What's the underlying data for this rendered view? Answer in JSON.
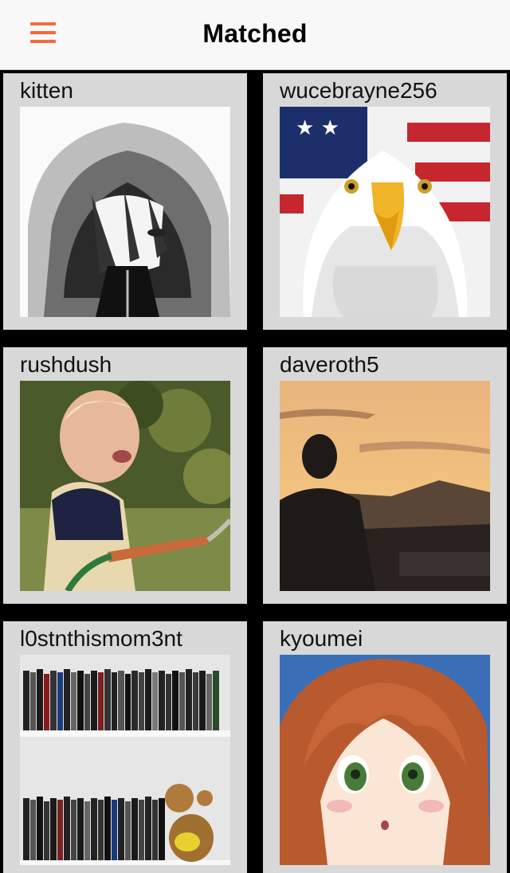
{
  "header": {
    "title": "Matched",
    "menu_icon": "hamburger-menu-icon",
    "accent_color": "#f26b3a"
  },
  "matches": [
    {
      "username": "kitten",
      "photo": "anime-hooded-girl-manga"
    },
    {
      "username": "wucebrayne256",
      "photo": "bald-eagle-american-flag"
    },
    {
      "username": "rushdush",
      "photo": "crying-toddler-garden-hose"
    },
    {
      "username": "daveroth5",
      "photo": "man-silhouette-sunset"
    },
    {
      "username": "l0stnthismom3nt",
      "photo": "bookshelf-video-games"
    },
    {
      "username": "kyoumei",
      "photo": "anime-girl-orange-hair"
    }
  ]
}
